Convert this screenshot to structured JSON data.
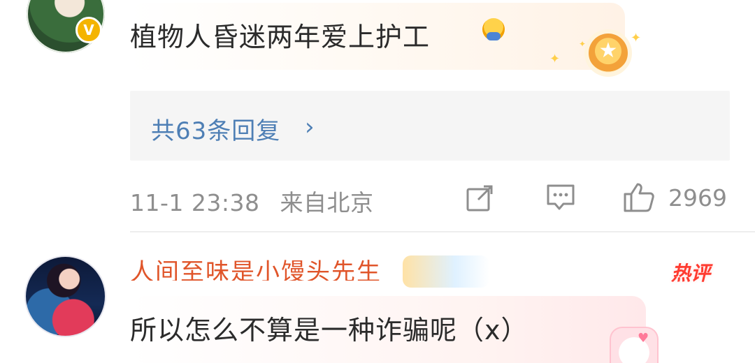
{
  "comment1": {
    "text": "植物人昏迷两年爱上护工",
    "emoji_icon": "duck-emoji-icon",
    "badge_icon": "verified-v-icon",
    "badge_label": "V",
    "star_badge_icon": "gold-star-badge-icon"
  },
  "replies": {
    "label": "共63条回复",
    "arrow": "›"
  },
  "meta": {
    "timestamp": "11-1 23:38",
    "location": "来自北京",
    "share_icon": "share-edit-icon",
    "comment_icon": "comment-bubble-icon",
    "like_icon": "thumbs-up-icon",
    "like_count": "2969"
  },
  "comment2": {
    "username_partial": "人间至味是小馒头先生",
    "hot_badge": "热评",
    "text": "所以怎么不算是一种诈骗呢（x）"
  },
  "colors": {
    "link_blue": "#4e7fb5",
    "meta_gray": "#8e8e8e",
    "hot_red": "#ff3b30"
  }
}
